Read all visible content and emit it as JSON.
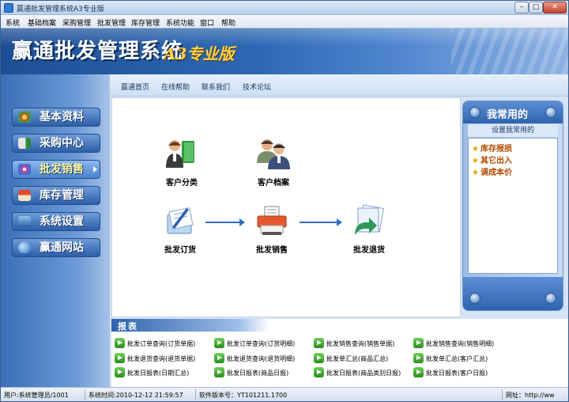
{
  "window": {
    "title": "赢通批发管理系统A3专业版",
    "min": "–",
    "max": "□",
    "close": "✕"
  },
  "menu": [
    "系统",
    "基础档案",
    "采购管理",
    "批发管理",
    "库存管理",
    "系统功能",
    "窗口",
    "帮助"
  ],
  "banner": {
    "logo": "赢通批发管理系统",
    "edition": "A3专业版"
  },
  "topnav": [
    "赢通首页",
    "在线帮助",
    "联系我们",
    "技术论坛"
  ],
  "sidebar": [
    {
      "label": "基本资料",
      "icon": "puzzle-icon",
      "active": false
    },
    {
      "label": "采购中心",
      "icon": "truck-icon",
      "active": false
    },
    {
      "label": "批发销售",
      "icon": "gift-icon",
      "active": true
    },
    {
      "label": "库存管理",
      "icon": "house-icon",
      "active": false
    },
    {
      "label": "系统设置",
      "icon": "gear-monitor-icon",
      "active": false
    },
    {
      "label": "赢通网站",
      "icon": "globe-icon",
      "active": false
    }
  ],
  "workflow": {
    "customer_category": "客户分类",
    "customer_file": "客户档案",
    "wholesale_order": "批发订货",
    "wholesale_sale": "批发销售",
    "wholesale_return": "批发退货"
  },
  "favorites": {
    "title": "我常用的",
    "setup": "设置我常用的",
    "items": [
      "库存报损",
      "其它出入",
      "调成本价"
    ]
  },
  "reports": {
    "title": "报表",
    "items": [
      [
        "批发订单查询(订货单据)",
        "批发订单查询(订货明细)",
        "批发销售查询(销售单据)",
        "批发销售查询(销售明细)"
      ],
      [
        "批发退货查询(退货单据)",
        "批发退货查询(退货明细)",
        "批发单汇总(商品汇总)",
        "批发单汇总(客户汇总)"
      ],
      [
        "批发日报表(日期汇总)",
        "批发日报表(商品日报)",
        "批发日报表(商品类别日报)",
        "批发日报表(客户日报)"
      ]
    ]
  },
  "status": {
    "user": "用户:系统管理员/1001",
    "time": "系统时间:2010-12-12 21:59:57",
    "version": "软件版本号：YT101211.1700",
    "website": "网址：http://ww"
  }
}
